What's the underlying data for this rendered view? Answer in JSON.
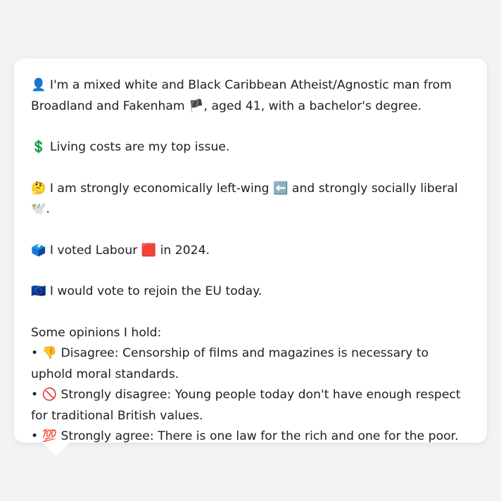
{
  "profile": {
    "identity": {
      "emoji": "👤",
      "text": "I'm a mixed white and Black Caribbean Atheist/Agnostic man from Broadland and Fakenham",
      "flag": "🏴",
      "text_after": ", aged 41, with a bachelor's degree."
    },
    "issue": {
      "emoji": "💲",
      "text": "Living costs are my top issue."
    },
    "ideology": {
      "emoji": "🤔",
      "text_a": "I am strongly economically left-wing",
      "emoji_left": "⬅️",
      "text_b": "and strongly socially liberal",
      "emoji_dove": "🕊️",
      "text_c": "."
    },
    "vote": {
      "emoji": "🗳️",
      "text_a": "I voted Labour",
      "emoji_party": "🟥",
      "text_b": "in 2024."
    },
    "eu": {
      "emoji": "🇪🇺",
      "text": "I would vote to rejoin the EU today."
    },
    "opinions_heading": "Some opinions I hold:",
    "opinions": [
      {
        "bullet": "•",
        "emoji": "👎",
        "stance": "Disagree:",
        "statement": "Censorship of films and magazines is necessary to uphold moral standards."
      },
      {
        "bullet": "•",
        "emoji": "🚫",
        "stance": "Strongly disagree:",
        "statement": "Young people today don't have enough respect for traditional British values."
      },
      {
        "bullet": "•",
        "emoji": "💯",
        "stance": "Strongly agree:",
        "statement": "There is one law for the rich and one for the poor."
      }
    ]
  }
}
